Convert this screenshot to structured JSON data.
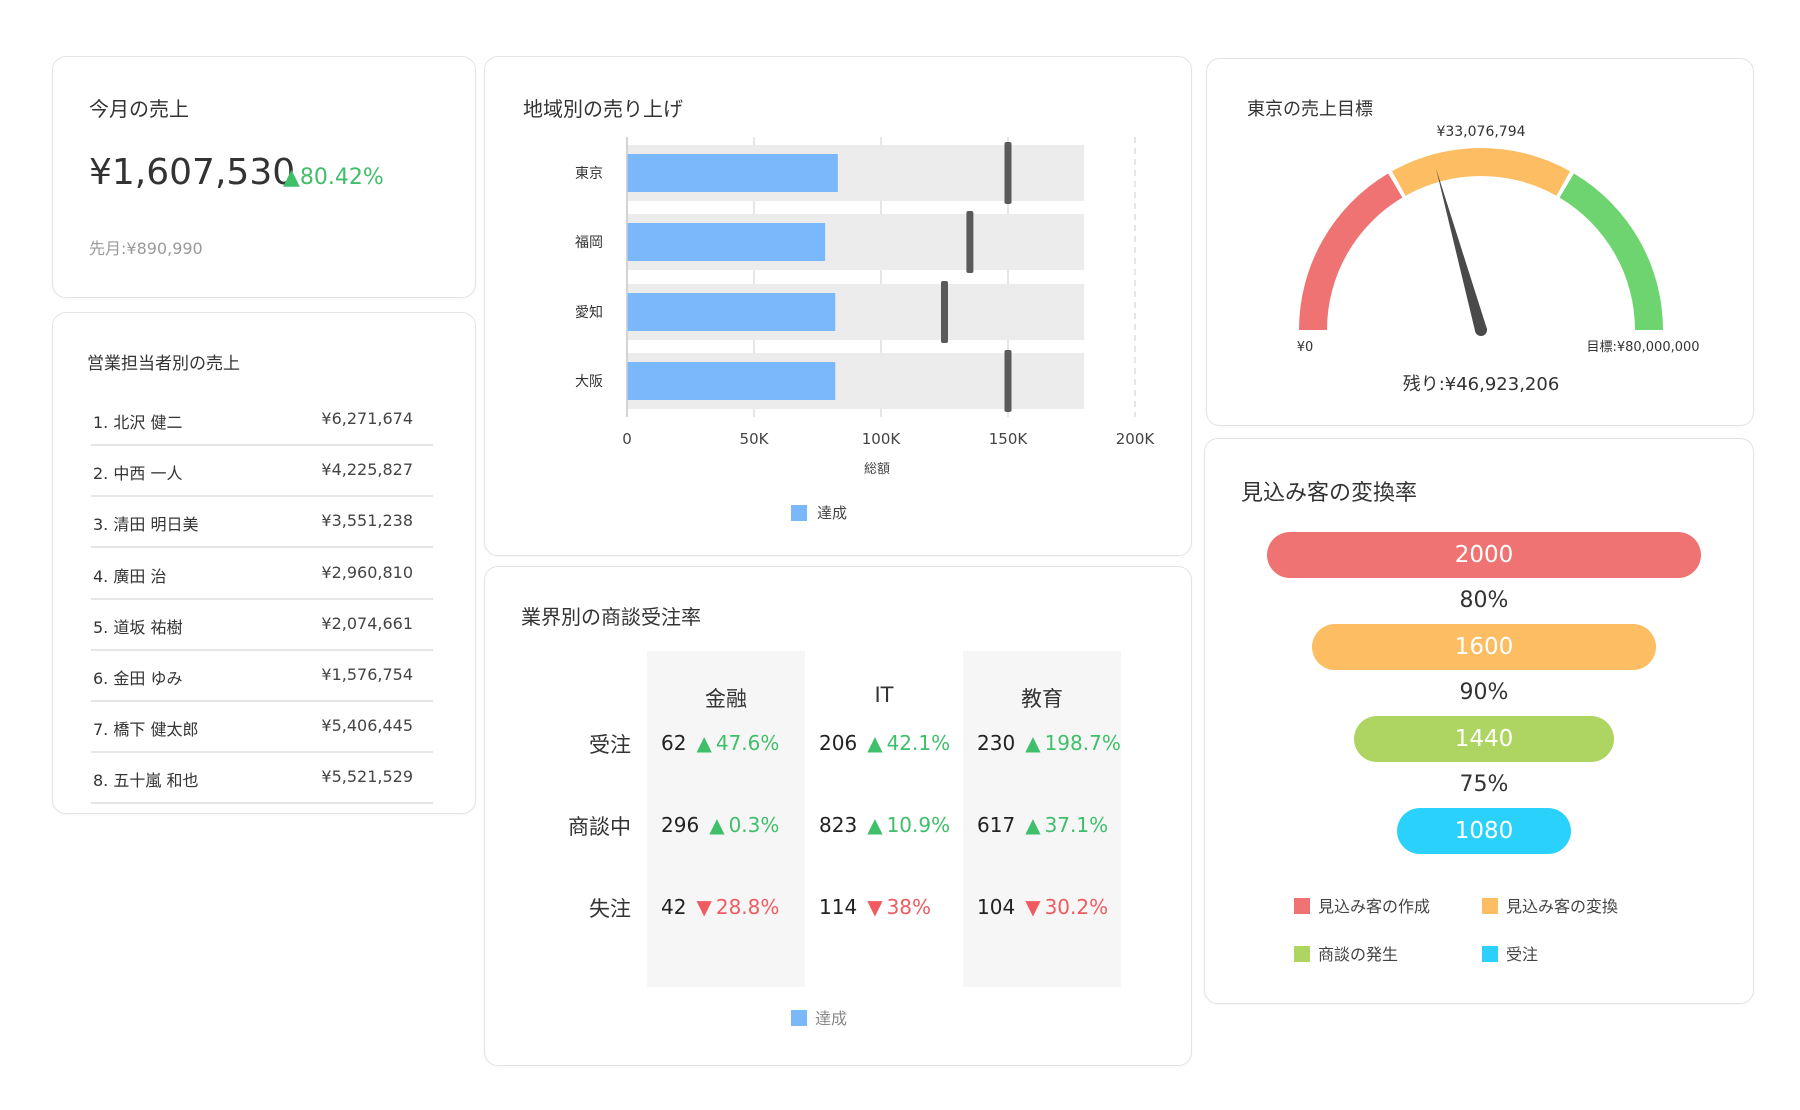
{
  "sales": {
    "title": "今月の売上",
    "amount": "¥1,607,530",
    "delta": "80.42%",
    "previous": "先月:¥890,990"
  },
  "reps": {
    "title": "営業担当者別の売上",
    "rows": [
      {
        "name": "1. 北沢 健二",
        "amount": "¥6,271,674"
      },
      {
        "name": "2. 中西 一人",
        "amount": "¥4,225,827"
      },
      {
        "name": "3. 清田 明日美",
        "amount": "¥3,551,238"
      },
      {
        "name": "4. 廣田 治",
        "amount": "¥2,960,810"
      },
      {
        "name": "5. 道坂 祐樹",
        "amount": "¥2,074,661"
      },
      {
        "name": "6. 金田 ゆみ",
        "amount": "¥1,576,754"
      },
      {
        "name": "7. 橋下 健太郎",
        "amount": "¥5,406,445"
      },
      {
        "name": "8. 五十嵐 和也",
        "amount": "¥5,521,529"
      }
    ]
  },
  "regional": {
    "title": "地域別の売り上げ",
    "legend": "達成",
    "colors": {
      "actual": "#7ab8fb",
      "range": "#ececec",
      "target": "#5a5a5a"
    }
  },
  "chart_data": [
    {
      "type": "bar",
      "subtype": "bullet",
      "title": "地域別の売り上げ",
      "categories": [
        "東京",
        "福岡",
        "愛知",
        "大阪"
      ],
      "series": [
        {
          "name": "達成",
          "values": [
            83000,
            78000,
            82000,
            82000
          ]
        },
        {
          "values": [
            180000,
            180000,
            180000,
            180000
          ]
        },
        {
          "values": [
            150000,
            135000,
            125000,
            150000
          ]
        }
      ],
      "xlabel": "総額",
      "xlim": [
        0,
        200000
      ],
      "xticks": [
        0,
        50000,
        100000,
        150000,
        200000
      ],
      "xtick_labels": [
        "0",
        "50K",
        "100K",
        "150K",
        "200K"
      ],
      "legend": "bottom",
      "grid": true
    },
    {
      "type": "gauge",
      "title": "東京の売上目標",
      "min": 0,
      "max": 80000000,
      "value": 33076794,
      "min_label": "¥0",
      "max_label": "目標:¥80,000,000",
      "value_label": "¥33,076,794",
      "remaining_label": "残り:¥46,923,206",
      "bands": [
        {
          "from": 0,
          "to": 26666667,
          "color": "#f07373"
        },
        {
          "from": 26666667,
          "to": 53333333,
          "color": "#fdbd62"
        },
        {
          "from": 53333333,
          "to": 80000000,
          "color": "#6dd46f"
        }
      ]
    },
    {
      "type": "funnel",
      "title": "見込み客の変換率",
      "categories": [
        "見込み客の作成",
        "見込み客の変換",
        "商談の発生",
        "受注"
      ],
      "values": [
        2000,
        1600,
        1440,
        1080
      ],
      "conversion_labels": [
        "80%",
        "90%",
        "75%"
      ],
      "colors": [
        "#f07373",
        "#fdbd62",
        "#aed561",
        "#2ad2fb"
      ],
      "legend": "bottom"
    }
  ],
  "industry": {
    "title": "業界別の商談受注率",
    "columns": [
      "金融",
      "IT",
      "教育"
    ],
    "rows": [
      {
        "label": "受注",
        "cells": [
          {
            "value": "62",
            "change": "47.6%",
            "dir": "up"
          },
          {
            "value": "206",
            "change": "42.1%",
            "dir": "up"
          },
          {
            "value": "230",
            "change": "198.7%",
            "dir": "up"
          }
        ]
      },
      {
        "label": "商談中",
        "cells": [
          {
            "value": "296",
            "change": "0.3%",
            "dir": "up"
          },
          {
            "value": "823",
            "change": "10.9%",
            "dir": "up"
          },
          {
            "value": "617",
            "change": "37.1%",
            "dir": "up"
          }
        ]
      },
      {
        "label": "失注",
        "cells": [
          {
            "value": "42",
            "change": "28.8%",
            "dir": "down"
          },
          {
            "value": "114",
            "change": "38%",
            "dir": "down"
          },
          {
            "value": "104",
            "change": "30.2%",
            "dir": "down"
          }
        ]
      }
    ],
    "legend": "達成",
    "colors": {
      "up": "#3fbf6a",
      "down": "#ef5b60",
      "legend": "#7ab8fb"
    }
  },
  "gauge": {
    "title": "東京の売上目標"
  },
  "funnel": {
    "title": "見込み客の変換率"
  }
}
